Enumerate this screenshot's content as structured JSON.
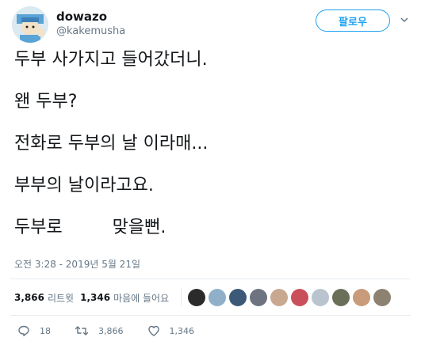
{
  "user": {
    "display_name": "dowazo",
    "handle": "@kakemusha"
  },
  "follow_button": {
    "label": "팔로우"
  },
  "tweet": {
    "lines": [
      "두부 사가지고 들어갔더니.",
      "왠 두부?",
      "전화로 두부의 날 이라매...",
      "부부의 날이라고요.",
      "두부로         맞을뻔."
    ],
    "timestamp": "오전 3:28 - 2019년 5월 21일"
  },
  "stats": {
    "retweets_count": "3,866",
    "retweets_label": "리트윗",
    "likes_count": "1,346",
    "likes_label": "마음에 들어요"
  },
  "likers": {
    "colors": [
      "#2b2b2b",
      "#8fb0c8",
      "#3c5a78",
      "#6d7480",
      "#c8a890",
      "#c94f5a",
      "#b9c4cf",
      "#6a6f5a",
      "#c89b7a",
      "#8d8170"
    ]
  },
  "actions": {
    "replies": "18",
    "retweets": "3,866",
    "likes": "1,346"
  },
  "colors": {
    "accent": "#1da1f2",
    "text": "#14171a",
    "muted": "#657786"
  }
}
